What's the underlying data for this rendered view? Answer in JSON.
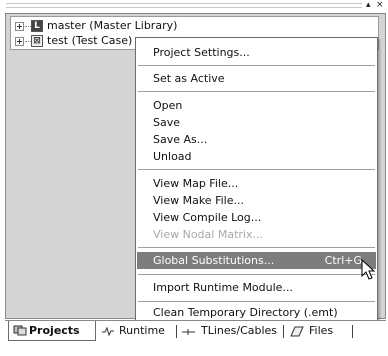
{
  "titlebar": {
    "pin": "▴",
    "close": "×"
  },
  "tree": {
    "items": [
      {
        "label": "master (Master Library)",
        "icon": "library-icon",
        "icon_glyph": "L"
      },
      {
        "label": "test (Test Case)",
        "icon": "test-case-icon",
        "icon_glyph": "⊠"
      }
    ]
  },
  "menu": {
    "items": [
      {
        "label": "Project Settings...",
        "disabled": false
      },
      {
        "label": "Set as Active",
        "disabled": false
      },
      {
        "label": "Open",
        "disabled": false
      },
      {
        "label": "Save",
        "disabled": false
      },
      {
        "label": "Save As...",
        "disabled": false
      },
      {
        "label": "Unload",
        "disabled": false
      },
      {
        "label": "View Map File...",
        "disabled": false
      },
      {
        "label": "View Make File...",
        "disabled": false
      },
      {
        "label": "View Compile Log...",
        "disabled": false
      },
      {
        "label": "View Nodal Matrix...",
        "disabled": true
      },
      {
        "label": "Global Substitutions...",
        "shortcut": "Ctrl+G",
        "highlighted": true
      },
      {
        "label": "Import Runtime Module...",
        "disabled": false
      },
      {
        "label": "Clean Temporary Directory (.emt)",
        "disabled": false
      }
    ]
  },
  "tabs": [
    {
      "label": "Projects",
      "icon": "projects-icon",
      "active": true
    },
    {
      "label": "Runtime",
      "icon": "runtime-icon",
      "active": false
    },
    {
      "label": "TLines/Cables",
      "icon": "tlines-icon",
      "active": false
    },
    {
      "label": "Files",
      "icon": "files-icon",
      "active": false
    }
  ]
}
